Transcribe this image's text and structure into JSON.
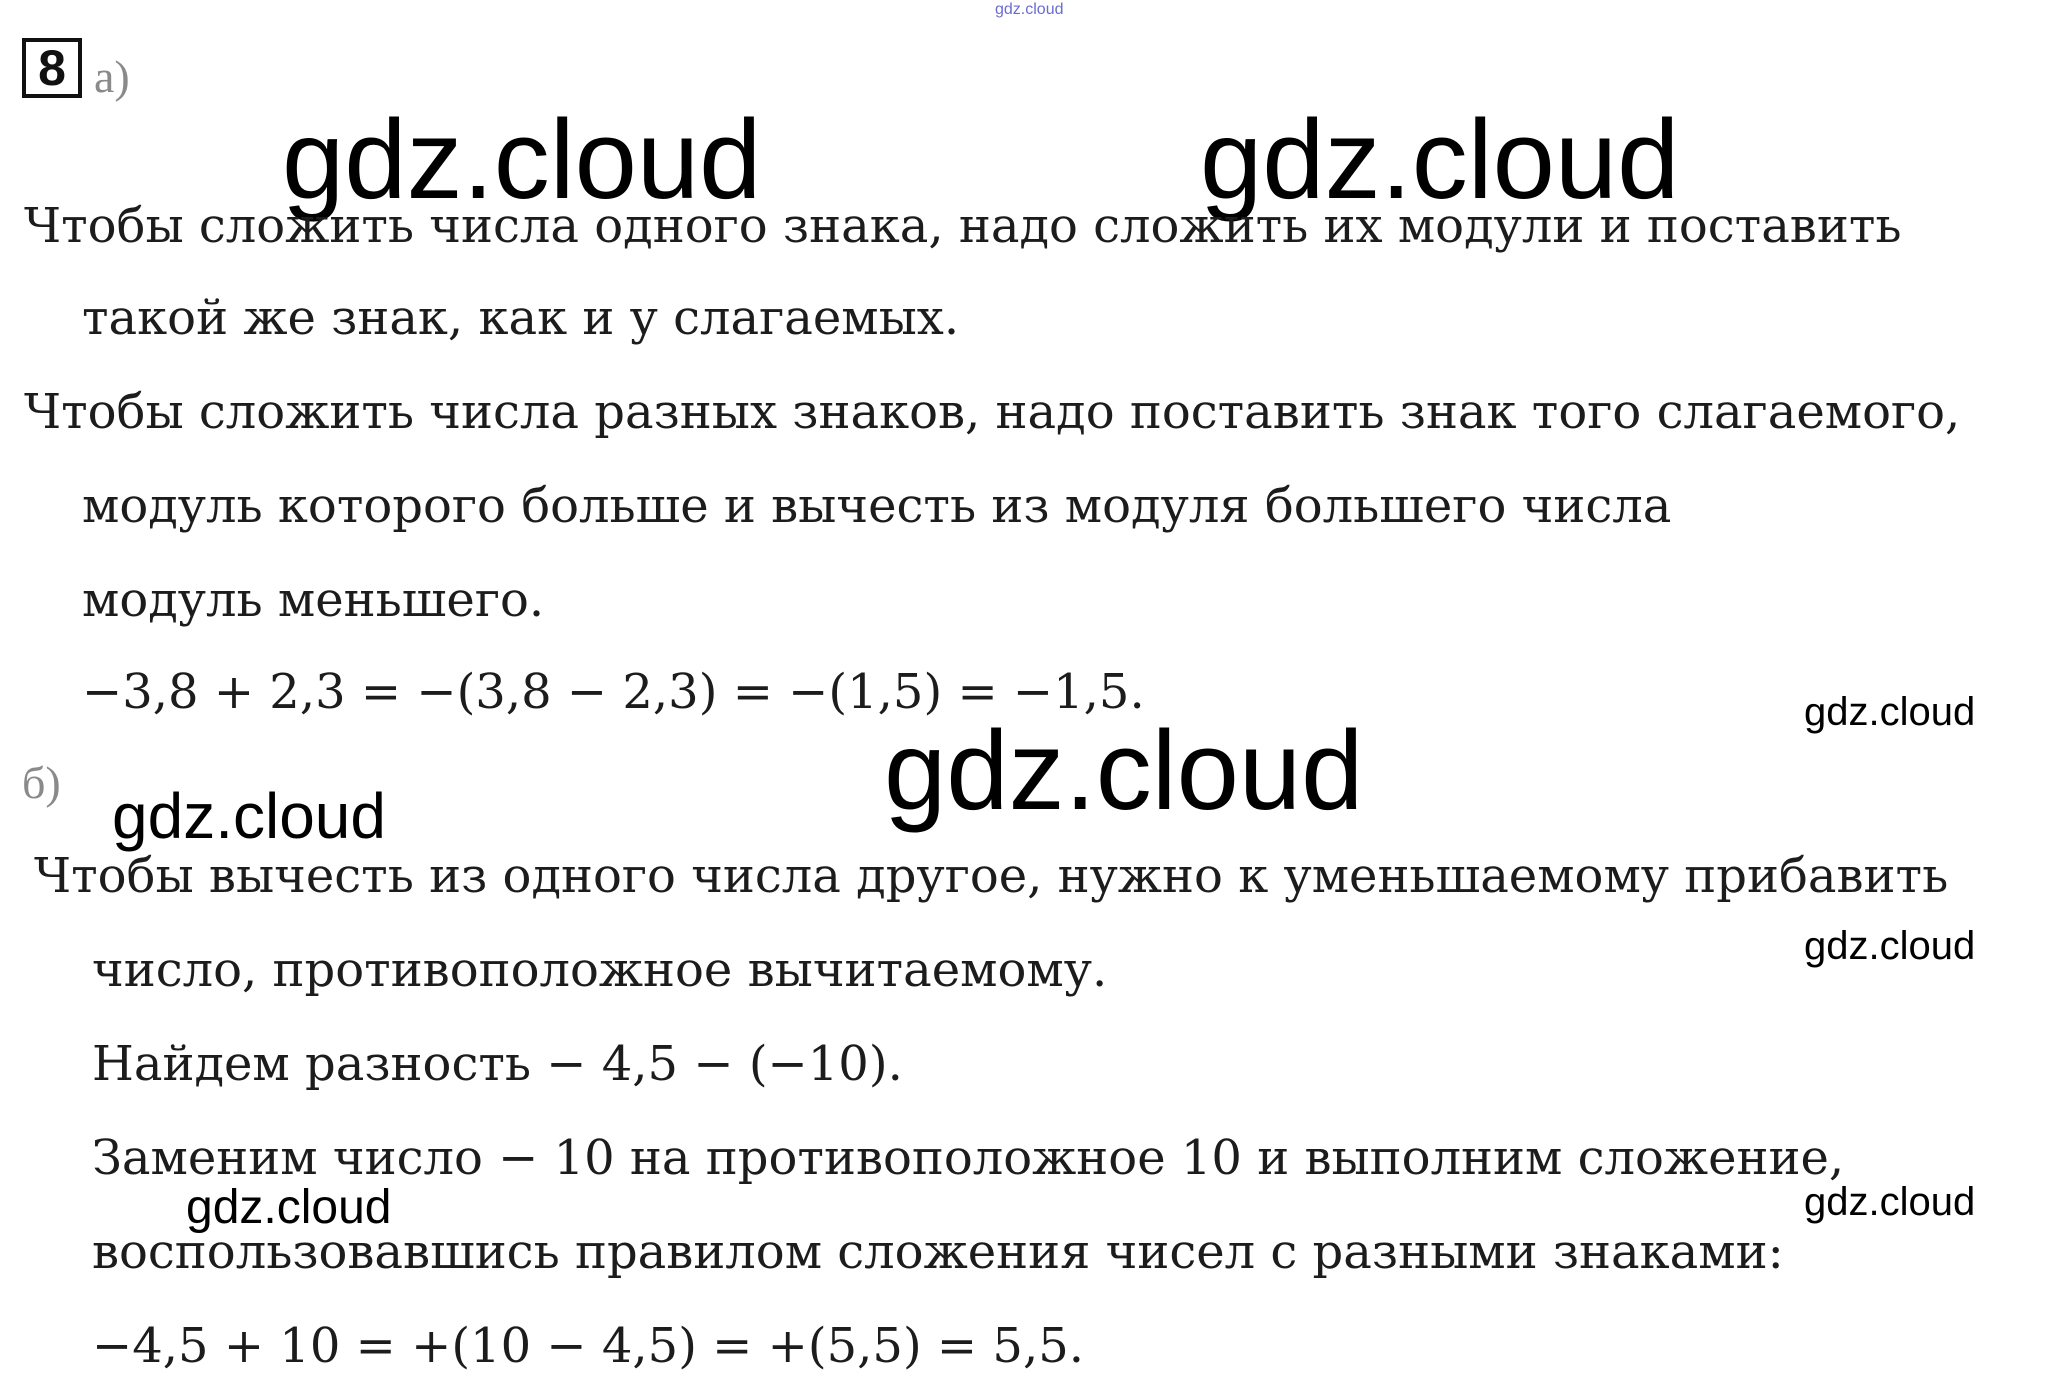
{
  "task_number": "8",
  "watermarks": {
    "top_small": "gdz.cloud",
    "big_1": "gdz.cloud",
    "big_2": "gdz.cloud",
    "big_3": "gdz.cloud",
    "mid_1": "gdz.cloud",
    "mid_2": "gdz.cloud",
    "small_1": "gdz.cloud",
    "small_2": "gdz.cloud",
    "small_3": "gdz.cloud"
  },
  "part_a": {
    "label": "а)",
    "lines": [
      "Чтобы сложить числа одного знака, надо сложить их модули и поставить",
      "такой же знак, как и у слагаемых.",
      "Чтобы сложить числа разных знаков, надо поставить знак того слагаемого,",
      "модуль которого больше и вычесть из модуля большего числа",
      "модуль меньшего.",
      "−3,8 + 2,3 = −(3,8 − 2,3) = −(1,5) = −1,5."
    ]
  },
  "part_b": {
    "label": "б)",
    "lines": [
      "Чтобы вычесть из одного числа другое, нужно к уменьшаемому прибавить",
      "число, противоположное вычитаемому.",
      "Найдем разность − 4,5 − (−10).",
      "Заменим число − 10 на противоположное 10 и выполним сложение,",
      "воспользовавшись правилом сложения чисел с разными знаками:",
      "−4,5 + 10 = +(10 − 4,5) = +(5,5) = 5,5."
    ]
  }
}
